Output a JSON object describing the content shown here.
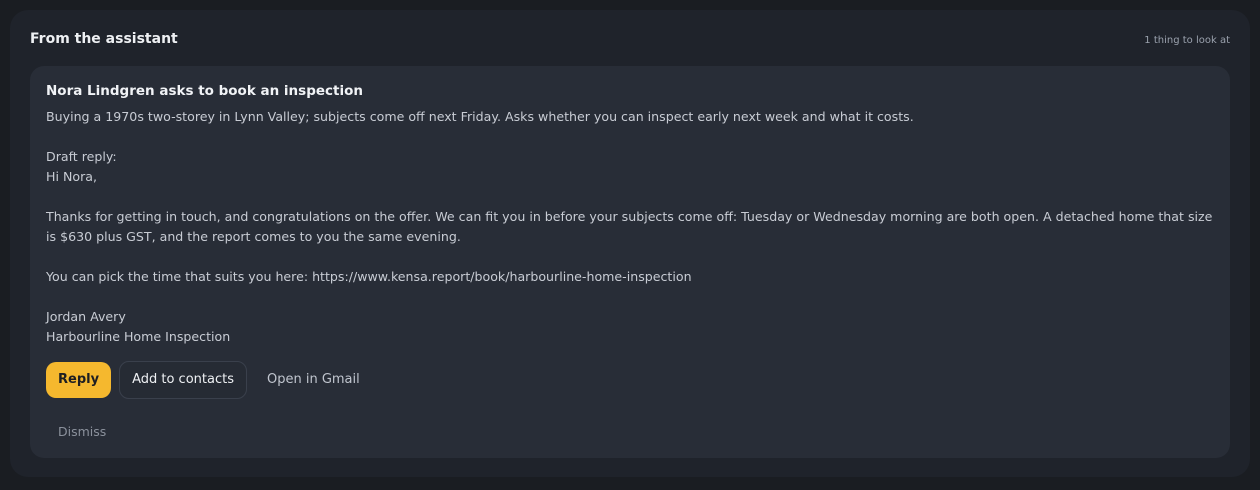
{
  "panel": {
    "title": "From the assistant",
    "meta": "1 thing to look at"
  },
  "card": {
    "title": "Nora Lindgren asks to book an inspection",
    "summary": "Buying a 1970s two-storey in Lynn Valley; subjects come off next Friday. Asks whether you can inspect early next week and what it costs.",
    "draft_label": "Draft reply:",
    "greeting": "Hi Nora,",
    "paragraph1": "Thanks for getting in touch, and congratulations on the offer. We can fit you in before your subjects come off: Tuesday or Wednesday morning are both open. A detached home that size is $630 plus GST, and the report comes to you the same evening.",
    "paragraph2": "You can pick the time that suits you here: https://www.kensa.report/book/harbourline-home-inspection",
    "signature_name": "Jordan Avery",
    "signature_company": "Harbourline Home Inspection"
  },
  "actions": {
    "reply_label": "Reply",
    "add_contacts_label": "Add to contacts",
    "open_gmail_label": "Open in Gmail",
    "dismiss_label": "Dismiss"
  },
  "colors": {
    "accent": "#f5b82e",
    "panel_bg": "#1f232b",
    "card_bg": "#282d37"
  }
}
